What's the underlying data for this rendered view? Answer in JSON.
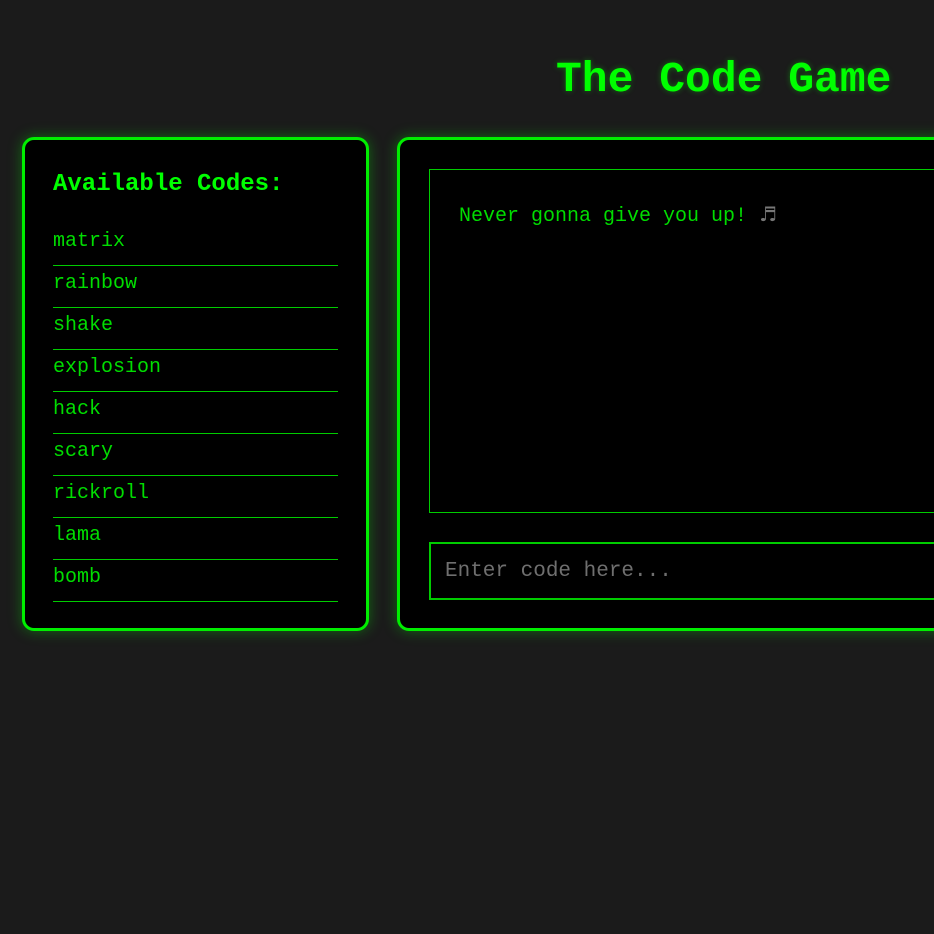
{
  "header": {
    "title": "The Code Game"
  },
  "sidebar": {
    "heading": "Available Codes:",
    "codes": [
      "matrix",
      "rainbow",
      "shake",
      "explosion",
      "hack",
      "scary",
      "rickroll",
      "lama",
      "bomb"
    ]
  },
  "output": {
    "message": "Never gonna give you up!",
    "icon": "music-note-icon",
    "icon_glyph": "♬"
  },
  "input": {
    "placeholder": "Enter code here...",
    "value": ""
  },
  "colors": {
    "background": "#1b1b1b",
    "panel": "#000000",
    "accent": "#00ff00",
    "placeholder": "#6f6f6f"
  }
}
